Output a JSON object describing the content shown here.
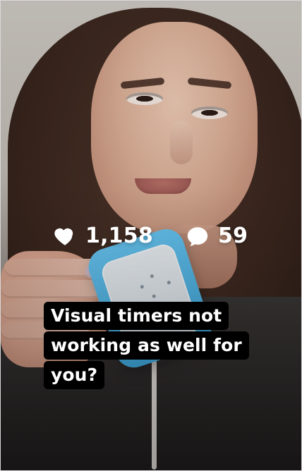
{
  "post": {
    "likes_count": "1,158",
    "comments_count": "59",
    "caption_lines": [
      "Visual timers not",
      "working as well for",
      "you?"
    ],
    "icons": {
      "likes": "heart-icon",
      "comments": "comment-icon"
    },
    "colors": {
      "overlay_text": "#ffffff",
      "caption_bg": "#000000",
      "timer_accent": "#3da6db"
    }
  }
}
